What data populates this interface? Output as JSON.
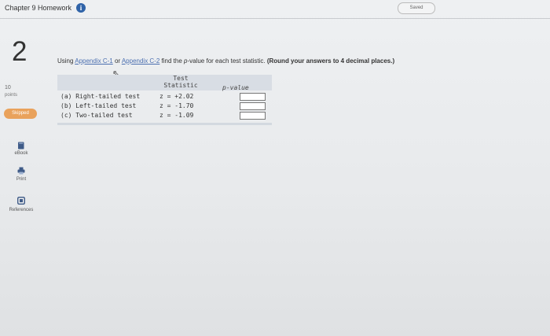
{
  "header": {
    "title": "Chapter 9 Homework",
    "info_icon": "info-icon",
    "saved_label": "Saved"
  },
  "sidebar": {
    "question_number": "2",
    "points_value": "10",
    "points_label": "points",
    "skipped_label": "Skipped",
    "items": [
      {
        "icon": "book-icon",
        "label": "eBook"
      },
      {
        "icon": "print-icon",
        "label": "Print"
      },
      {
        "icon": "references-icon",
        "label": "References"
      }
    ]
  },
  "question": {
    "prefix": "Using ",
    "link1": "Appendix C-1",
    "mid": " or ",
    "link2": "Appendix C-2",
    "text1": " find the ",
    "pvar": "p",
    "text2": "-value for each test statistic. ",
    "instruction": "(Round your answers to 4 decimal places.)"
  },
  "table": {
    "col_test": "Test",
    "col_stat": "Statistic",
    "col_p": "p-value",
    "rows": [
      {
        "label": "(a) Right-tailed test",
        "stat": "z = +2.02",
        "answer": ""
      },
      {
        "label": "(b) Left-tailed test",
        "stat": "z = -1.70",
        "answer": ""
      },
      {
        "label": "(c) Two-tailed test",
        "stat": "z = -1.09",
        "answer": ""
      }
    ]
  },
  "colors": {
    "accent_link": "#4b6fb0",
    "skipped_badge": "#e9a25c",
    "info_icon": "#2f63a8"
  }
}
